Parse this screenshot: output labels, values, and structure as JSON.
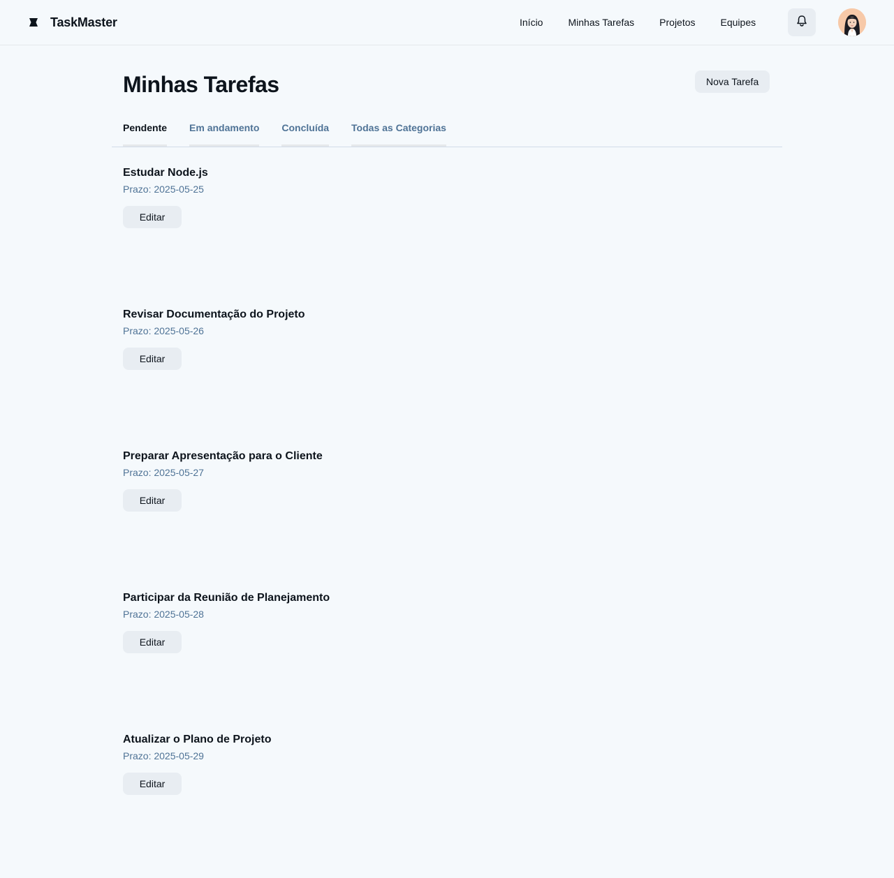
{
  "header": {
    "brand": "TaskMaster",
    "brand_icon": "logo-icon",
    "nav": [
      {
        "label": "Início"
      },
      {
        "label": "Minhas Tarefas"
      },
      {
        "label": "Projetos"
      },
      {
        "label": "Equipes"
      }
    ],
    "notification_icon": "bell-icon",
    "avatar_icon": "user-avatar"
  },
  "main": {
    "title": "Minhas Tarefas",
    "new_task_label": "Nova Tarefa",
    "tabs": [
      {
        "label": "Pendente",
        "active": true
      },
      {
        "label": "Em andamento",
        "active": false
      },
      {
        "label": "Concluída",
        "active": false
      },
      {
        "label": "Todas as Categorias",
        "active": false
      }
    ],
    "tasks": [
      {
        "title": "Estudar Node.js",
        "due": "Prazo: 2025-05-25",
        "edit_label": "Editar"
      },
      {
        "title": "Revisar Documentação do Projeto",
        "due": "Prazo: 2025-05-26",
        "edit_label": "Editar"
      },
      {
        "title": "Preparar Apresentação para o Cliente",
        "due": "Prazo: 2025-05-27",
        "edit_label": "Editar"
      },
      {
        "title": "Participar da Reunião de Planejamento",
        "due": "Prazo: 2025-05-28",
        "edit_label": "Editar"
      },
      {
        "title": "Atualizar o Plano de Projeto",
        "due": "Prazo: 2025-05-29",
        "edit_label": "Editar"
      }
    ]
  },
  "colors": {
    "background": "#f5f9fc",
    "text": "#0d141c",
    "muted": "#4f7396",
    "button": "#e8edf2"
  }
}
